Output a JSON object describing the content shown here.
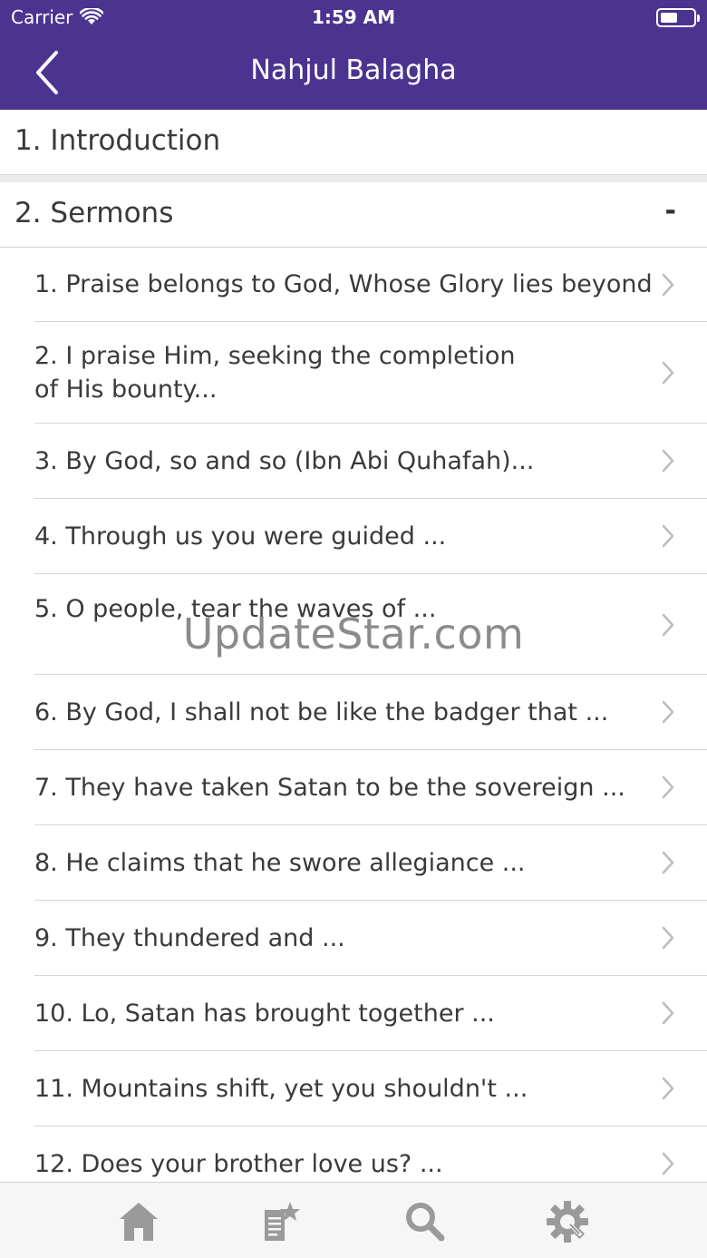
{
  "status_bar": {
    "carrier": "Carrier",
    "time": "1:59 AM"
  },
  "nav": {
    "title": "Nahjul Balagha",
    "back_icon": "chevron-left-icon"
  },
  "sections": {
    "intro_label": "1. Introduction",
    "sermons_label": "2. Sermons",
    "sermons_toggle": "-"
  },
  "sermons": [
    "1. Praise belongs to God, Whose Glory lies beyond",
    "2. I praise Him, seeking the completion of His bounty...",
    "3. By God, so and so (Ibn Abi Quhafah)...",
    "4. Through us you were guided ...",
    "5. O people, tear the waves of ...",
    "6. By God, I shall not be like the badger that ...",
    "7. They have taken Satan to be the sovereign ...",
    "8. He claims that he swore allegiance ...",
    "9. They thundered and ...",
    "10. Lo, Satan has brought together ...",
    "11. Mountains shift, yet you shouldn't ...",
    "12. Does your brother love us? ..."
  ],
  "watermark": "UpdateStar.com",
  "tabs": [
    {
      "icon": "home-icon"
    },
    {
      "icon": "bookmark-note-icon"
    },
    {
      "icon": "search-icon"
    },
    {
      "icon": "settings-gear-icon"
    }
  ],
  "colors": {
    "header": "#4b3490",
    "text": "#3a3a3a",
    "tab_icon": "#9a9a9a",
    "chevron": "#bdbdbd"
  }
}
